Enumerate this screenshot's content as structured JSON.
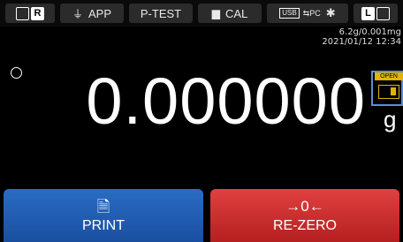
{
  "status_bar": {
    "range_mode": "R",
    "app_label": "APP",
    "ptest_label": "P-TEST",
    "cal_label": "CAL",
    "usb_label": "USB",
    "pc_label": "PC",
    "level_label": "L"
  },
  "info": {
    "capacity_readability": "6.2g/0.001mg",
    "datetime": "2021/01/12  12:34"
  },
  "display": {
    "weight_value": "0.000000",
    "unit": "g"
  },
  "door": {
    "label": "OPEN"
  },
  "buttons": {
    "print_label": "PRINT",
    "print_icon": "printer-icon",
    "rezero_icon_text": "→0←",
    "rezero_label": "RE-ZERO"
  },
  "colors": {
    "print_button": "#2a6cc4",
    "rezero_button": "#e04040",
    "door_accent": "#e0b400",
    "door_border": "#5a8fd6"
  }
}
